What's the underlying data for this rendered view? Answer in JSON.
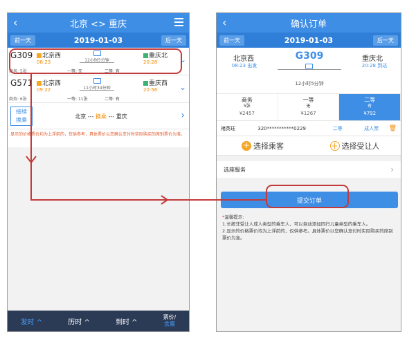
{
  "left": {
    "title": "北京 <> 重庆",
    "back_icon": "‹",
    "prev_day": "前一天",
    "date": "2019-01-03",
    "next_day": "后一天",
    "trains": [
      {
        "no": "G309",
        "from": "北京西",
        "from_time": "08:23",
        "duration": "12小时5分钟",
        "to": "重庆北",
        "to_time": "20:28",
        "left_seats": "商务: 5张",
        "class1": "一等: 无",
        "class2": "二等: 有"
      },
      {
        "no": "G571",
        "from": "北京西",
        "from_time": "09:22",
        "duration": "11小时34分钟",
        "to": "重庆西",
        "to_time": "20:56",
        "left_seats": "商务: 6张",
        "class1": "一等: 11张",
        "class2": "二等: 有"
      }
    ],
    "transfer_btn": "接续\n换乘",
    "transfer_from": "北京 --- ",
    "transfer_mid": "换乘",
    "transfer_to": " --- 重庆",
    "note": "显示的价格票价均为上浮前的，仅供参考，具体票价以您确认支付时实际购买的席别票价为准。",
    "bottom": {
      "depart": "发时 ^",
      "travel": "历时 ^",
      "arrive": "到时 ^",
      "price": "票价/",
      "remaining": "余票"
    }
  },
  "right": {
    "title": "确认订单",
    "back_icon": "‹",
    "prev_day": "前一天",
    "date": "2019-01-03",
    "next_day": "后一天",
    "train": {
      "no": "G309",
      "from": "北京西",
      "from_time": "08:23 出发",
      "duration": "12小时5分钟",
      "to": "重庆北",
      "to_time": "20:28 到达"
    },
    "seats": [
      {
        "name": "商务",
        "count": "5张",
        "price": "¥2457"
      },
      {
        "name": "一等",
        "count": "无",
        "price": "¥1267"
      },
      {
        "name": "二等",
        "count": "有",
        "price": "¥792"
      }
    ],
    "passenger": {
      "name": "褚英珏",
      "id": "320***********0229",
      "class": "二等",
      "type": "成人票"
    },
    "choose_passenger": "选择乘客",
    "choose_receiver": "选择受让人",
    "service": "选座服务",
    "submit": "提交订单",
    "tips_title": "温馨提示:",
    "tips": [
      "1.长按非受让人成人类型的乘车人，可以自动添加同行儿童类型的乘车人。",
      "2.显示的价格票价均为上浮前的，仅供参考。具体票价以您确认支付时实际购买的席别票价为准。"
    ]
  },
  "colors": {
    "primary": "#3e8ee6",
    "annotation": "#c23a3a",
    "accent": "#f08a00"
  }
}
